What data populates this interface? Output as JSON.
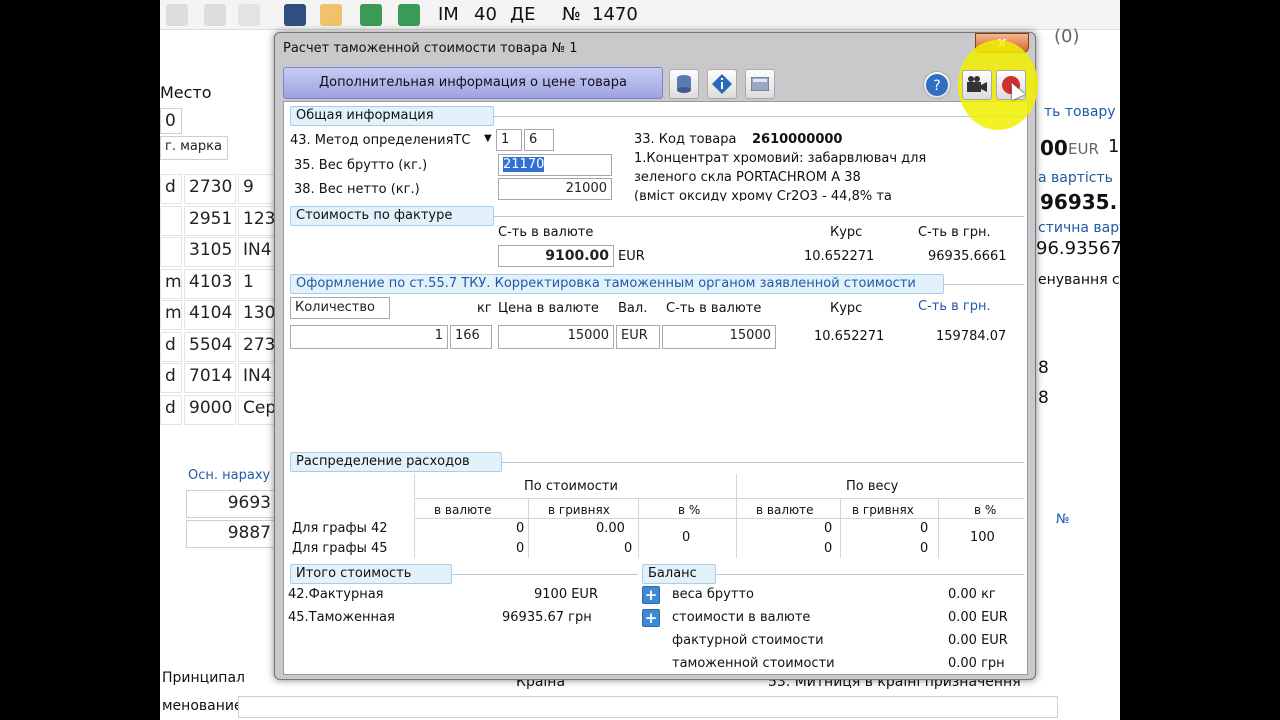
{
  "toolbar": {
    "im": "IM",
    "num1": "40",
    "de": "ДЕ",
    "no_sign": "№",
    "num2": "1470"
  },
  "background": {
    "mesto": "Место",
    "cell0": "0",
    "marka": "г. марка",
    "rows": [
      {
        "a": "d",
        "b": "2730",
        "c": "9"
      },
      {
        "a": "",
        "b": "2951",
        "c": "123"
      },
      {
        "a": "",
        "b": "3105",
        "c": "IN4"
      },
      {
        "a": "m",
        "b": "4103",
        "c": "1"
      },
      {
        "a": "m",
        "b": "4104",
        "c": "130"
      },
      {
        "a": "d",
        "b": "5504",
        "c": "273"
      },
      {
        "a": "d",
        "b": "7014",
        "c": "IN4"
      },
      {
        "a": "d",
        "b": "9000",
        "c": "Сер"
      }
    ],
    "osn": "Осн. нараху",
    "v1": "9693",
    "v2": "9887",
    "printsipal": "Принципал",
    "naimenovanie": "менование",
    "krayina": "Країна",
    "mytnytsi": "53. Митниця в країні призначення",
    "right_top": "(0)",
    "right_tovaru": "ть товару",
    "right_00": "00",
    "right_eur": "EUR",
    "right_1": "1",
    "right_vartist": "а вартість",
    "right_96935": "96935.",
    "right_stychna": "стична варт",
    "right_96935b": "96.93567",
    "right_naim": "енування ск",
    "right_8a": "8",
    "right_8b": "8",
    "right_no": "№"
  },
  "dialog": {
    "title": "Расчет таможенной стоимости товара № 1",
    "close": "x",
    "header": "Дополнительная информация о цене товара",
    "general": {
      "section": "Общая информация",
      "method_label": "43. Метод определенияТС",
      "method_v1": "1",
      "method_v2": "6",
      "gross_label": "35. Вес брутто (кг.)",
      "gross_value": "21170",
      "net_label": "38. Вес нетто (кг.)",
      "net_value": "21000",
      "code_label": "33. Код товара",
      "code_value": "2610000000",
      "desc1": "1.Концентрат хромовий: забарвлювач для",
      "desc2": "зеленого скла PORTACHROM A 38",
      "desc3": "(вміст оксиду хрому Cr2O3 - 44,8% та"
    },
    "invoice": {
      "section": "Стоимость по фактуре",
      "col_currency": "С-ть в валюте",
      "col_rate": "Курс",
      "col_uah": "С-ть в грн.",
      "amount": "9100.00",
      "currency": "EUR",
      "rate": "10.652271",
      "uah": "96935.6661"
    },
    "correction": {
      "section": "Оформление по ст.55.7 ТКУ. Корректировка таможенным органом заявленной стоимости",
      "qty_label": "Количество",
      "unit": "кг",
      "price_label": "Цена в валюте",
      "val_label": "Вал.",
      "cur_label": "С-ть в валюте",
      "rate_label": "Курс",
      "uah_label": "С-ть в грн.",
      "qty": "1",
      "unit_code": "166",
      "price": "15000",
      "val": "EUR",
      "cur": "15000",
      "rate": "10.652271",
      "uah": "159784.07"
    },
    "distribution": {
      "section": "Распределение расходов",
      "by_cost": "По стоимости",
      "by_weight": "По весу",
      "in_currency": "в валюте",
      "in_uah": "в гривнях",
      "in_pct": "в %",
      "row42": "Для графы 42",
      "row45": "Для графы 45",
      "c_cur_42": "0",
      "c_cur_45": "0",
      "c_uah_42": "0.00",
      "c_uah_45": "0",
      "c_pct": "0",
      "w_cur_42": "0",
      "w_cur_45": "0",
      "w_uah_42": "0",
      "w_uah_45": "0",
      "w_pct": "100"
    },
    "totals": {
      "section": "Итого  стоимость",
      "invoice_label": "42.Фактурная",
      "invoice_value": "9100 EUR",
      "customs_label": "45.Таможенная",
      "customs_value": "96935.67 грн"
    },
    "balance": {
      "section": "Баланс",
      "gross_label": "веса брутто",
      "gross_value": "0.00 кг",
      "cur_label": "стоимости в валюте",
      "cur_value": "0.00 EUR",
      "inv_label": "фактурной стоимости",
      "inv_value": "0.00 EUR",
      "cust_label": "таможенной стоимости",
      "cust_value": "0.00 грн"
    }
  }
}
